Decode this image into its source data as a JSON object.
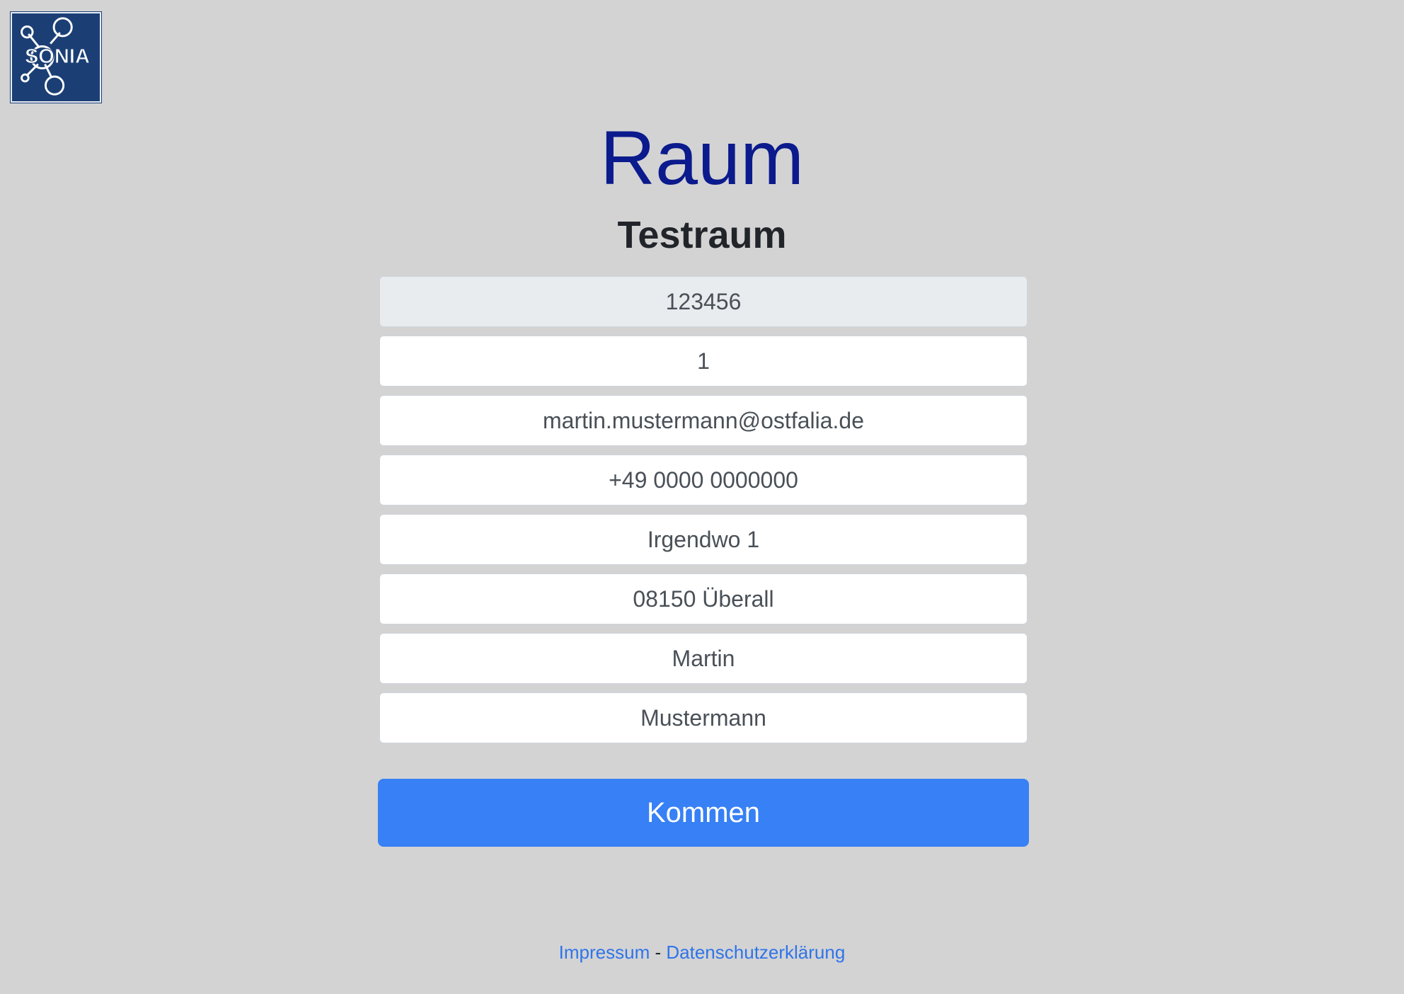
{
  "logo": {
    "text": "SONIA"
  },
  "page": {
    "title": "Raum",
    "room_name": "Testraum"
  },
  "form": {
    "fields": [
      {
        "value": "123456",
        "readonly": true
      },
      {
        "value": "1"
      },
      {
        "value": "martin.mustermann@ostfalia.de"
      },
      {
        "value": "+49 0000 0000000"
      },
      {
        "value": "Irgendwo 1"
      },
      {
        "value": "08150 Überall"
      },
      {
        "value": "Martin"
      },
      {
        "value": "Mustermann"
      }
    ],
    "submit_label": "Kommen"
  },
  "footer": {
    "impressum": "Impressum",
    "separator": "-",
    "privacy": "Datenschutzerklärung"
  },
  "colors": {
    "background": "#d3d3d4",
    "title": "#0b1a8c",
    "button": "#3780f5",
    "link": "#2f74e8",
    "logo_bg": "#1b3f75"
  }
}
